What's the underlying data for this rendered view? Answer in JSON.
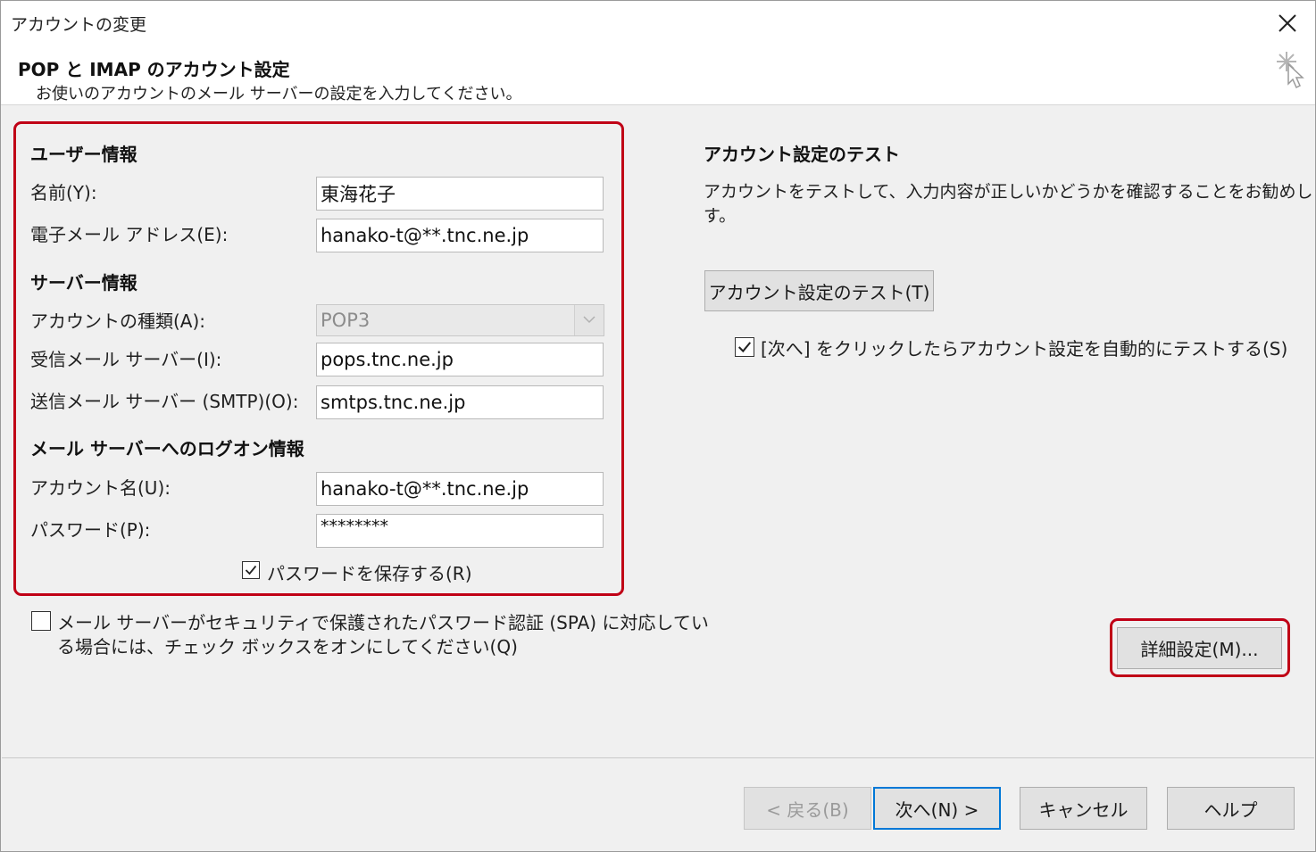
{
  "window": {
    "title": "アカウントの変更",
    "heading": "POP と IMAP のアカウント設定",
    "subheading": "お使いのアカウントのメール サーバーの設定を入力してください。"
  },
  "user_info": {
    "section_label": "ユーザー情報",
    "name_label": "名前(Y):",
    "name_value": "東海花子",
    "email_label": "電子メール アドレス(E):",
    "email_value": "hanako-t@**.tnc.ne.jp"
  },
  "server_info": {
    "section_label": "サーバー情報",
    "account_type_label": "アカウントの種類(A):",
    "account_type_value": "POP3",
    "incoming_label": "受信メール サーバー(I):",
    "incoming_value": "pops.tnc.ne.jp",
    "outgoing_label": "送信メール サーバー (SMTP)(O):",
    "outgoing_value": "smtps.tnc.ne.jp"
  },
  "logon_info": {
    "section_label": "メール サーバーへのログオン情報",
    "account_name_label": "アカウント名(U):",
    "account_name_value": "hanako-t@**.tnc.ne.jp",
    "password_label": "パスワード(P):",
    "password_value": "********",
    "save_password_label": "パスワードを保存する(R)",
    "save_password_checked": true
  },
  "spa": {
    "line1": "メール サーバーがセキュリティで保護されたパスワード認証 (SPA) に対応してい",
    "line2": "る場合には、チェック ボックスをオンにしてください(Q)",
    "checked": false
  },
  "test": {
    "section_label": "アカウント設定のテスト",
    "desc_line1": "アカウントをテストして、入力内容が正しいかどうかを確認することをお勧めしま",
    "desc_line2": "す。",
    "button_label": "アカウント設定のテスト(T)",
    "auto_test_label": "[次へ] をクリックしたらアカウント設定を自動的にテストする(S)",
    "auto_test_checked": true
  },
  "advanced_button_label": "詳細設定(M)...",
  "footer": {
    "back_label": "< 戻る(B)",
    "next_label": "次へ(N) >",
    "cancel_label": "キャンセル",
    "help_label": "ヘルプ"
  },
  "colors": {
    "highlight_red": "#c00016",
    "dialog_bg": "#f0f0f0",
    "focus_blue": "#0078d7"
  }
}
